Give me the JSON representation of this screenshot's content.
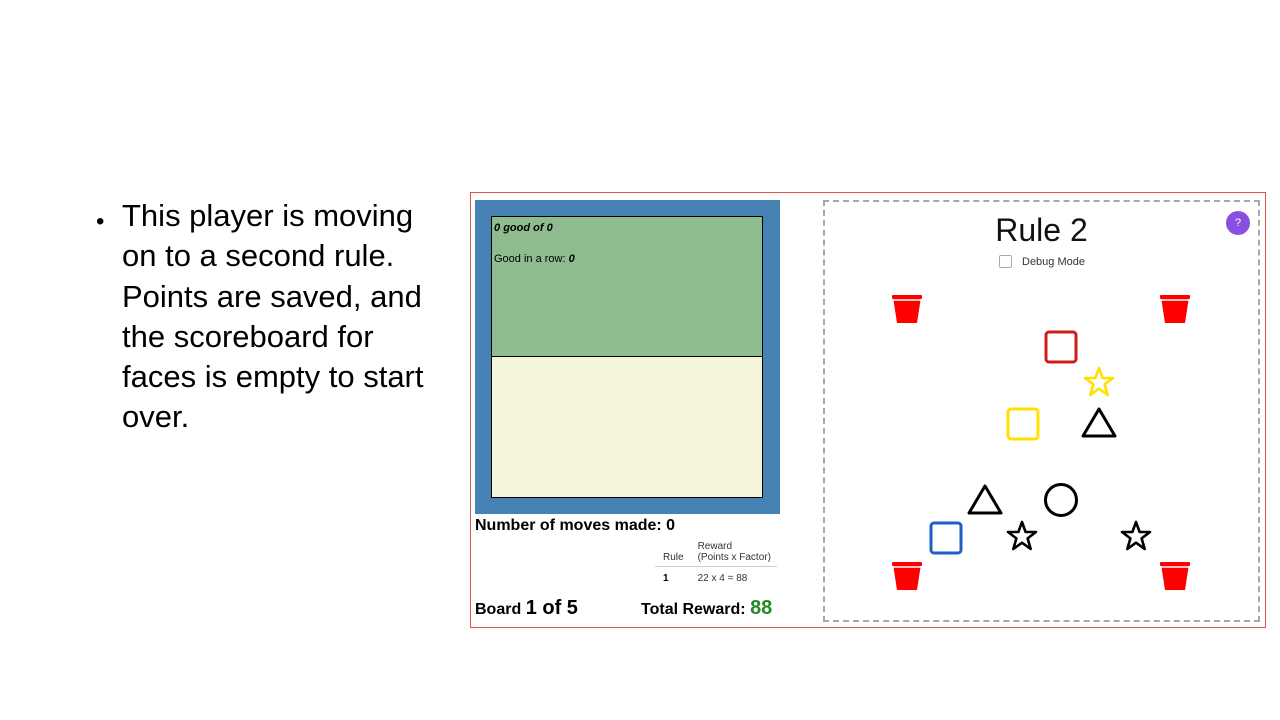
{
  "slide": {
    "bullet": "This player is moving on to a second rule. Points are saved, and the scoreboard for faces is empty to start over."
  },
  "scoreboard": {
    "good_count": "0",
    "good_of_text": "good of",
    "good_total": "0",
    "in_a_row_label": "Good in a row:",
    "in_a_row_value": "0"
  },
  "moves": {
    "label": "Number of moves made:",
    "value": "0"
  },
  "reward_table": {
    "headers": {
      "rule": "Rule",
      "reward_line1": "Reward",
      "reward_line2": "(Points x Factor)"
    },
    "rows": [
      {
        "rule": "1",
        "reward": "22 x 4 = 88"
      }
    ]
  },
  "board_counter": {
    "label": "Board",
    "value": "1 of 5"
  },
  "total_reward": {
    "label": "Total Reward:",
    "value": "88"
  },
  "game": {
    "title": "Rule 2",
    "debug_label": "Debug Mode",
    "debug_checked": false,
    "help_label": "?"
  },
  "colors": {
    "frame_border": "#d9534f",
    "scoreboard_blue": "#4682b4",
    "good_green": "#8fbc8f",
    "bad_beige": "#f5f5dc",
    "reward_green": "#228b22",
    "help_purple": "#8a4fe0",
    "bucket_red": "#ff0000",
    "piece_red": "#d11a1a",
    "piece_yellow": "#ffe000",
    "piece_blue": "#1f5fc4",
    "piece_black": "#000000"
  },
  "pieces": [
    {
      "name": "red-square-icon",
      "shape": "square",
      "color": "#d11a1a"
    },
    {
      "name": "yellow-star-icon",
      "shape": "star",
      "color": "#ffe000"
    },
    {
      "name": "yellow-square-icon",
      "shape": "square",
      "color": "#ffe000"
    },
    {
      "name": "black-triangle-icon",
      "shape": "triangle",
      "color": "#000000"
    },
    {
      "name": "black-triangle-icon",
      "shape": "triangle",
      "color": "#000000"
    },
    {
      "name": "black-circle-icon",
      "shape": "circle",
      "color": "#000000"
    },
    {
      "name": "blue-square-icon",
      "shape": "square",
      "color": "#1f5fc4"
    },
    {
      "name": "black-star-icon",
      "shape": "star",
      "color": "#000000"
    },
    {
      "name": "black-star-icon",
      "shape": "star",
      "color": "#000000"
    }
  ],
  "buckets": [
    {
      "name": "bucket-top-left-icon"
    },
    {
      "name": "bucket-top-right-icon"
    },
    {
      "name": "bucket-bottom-left-icon"
    },
    {
      "name": "bucket-bottom-right-icon"
    }
  ]
}
